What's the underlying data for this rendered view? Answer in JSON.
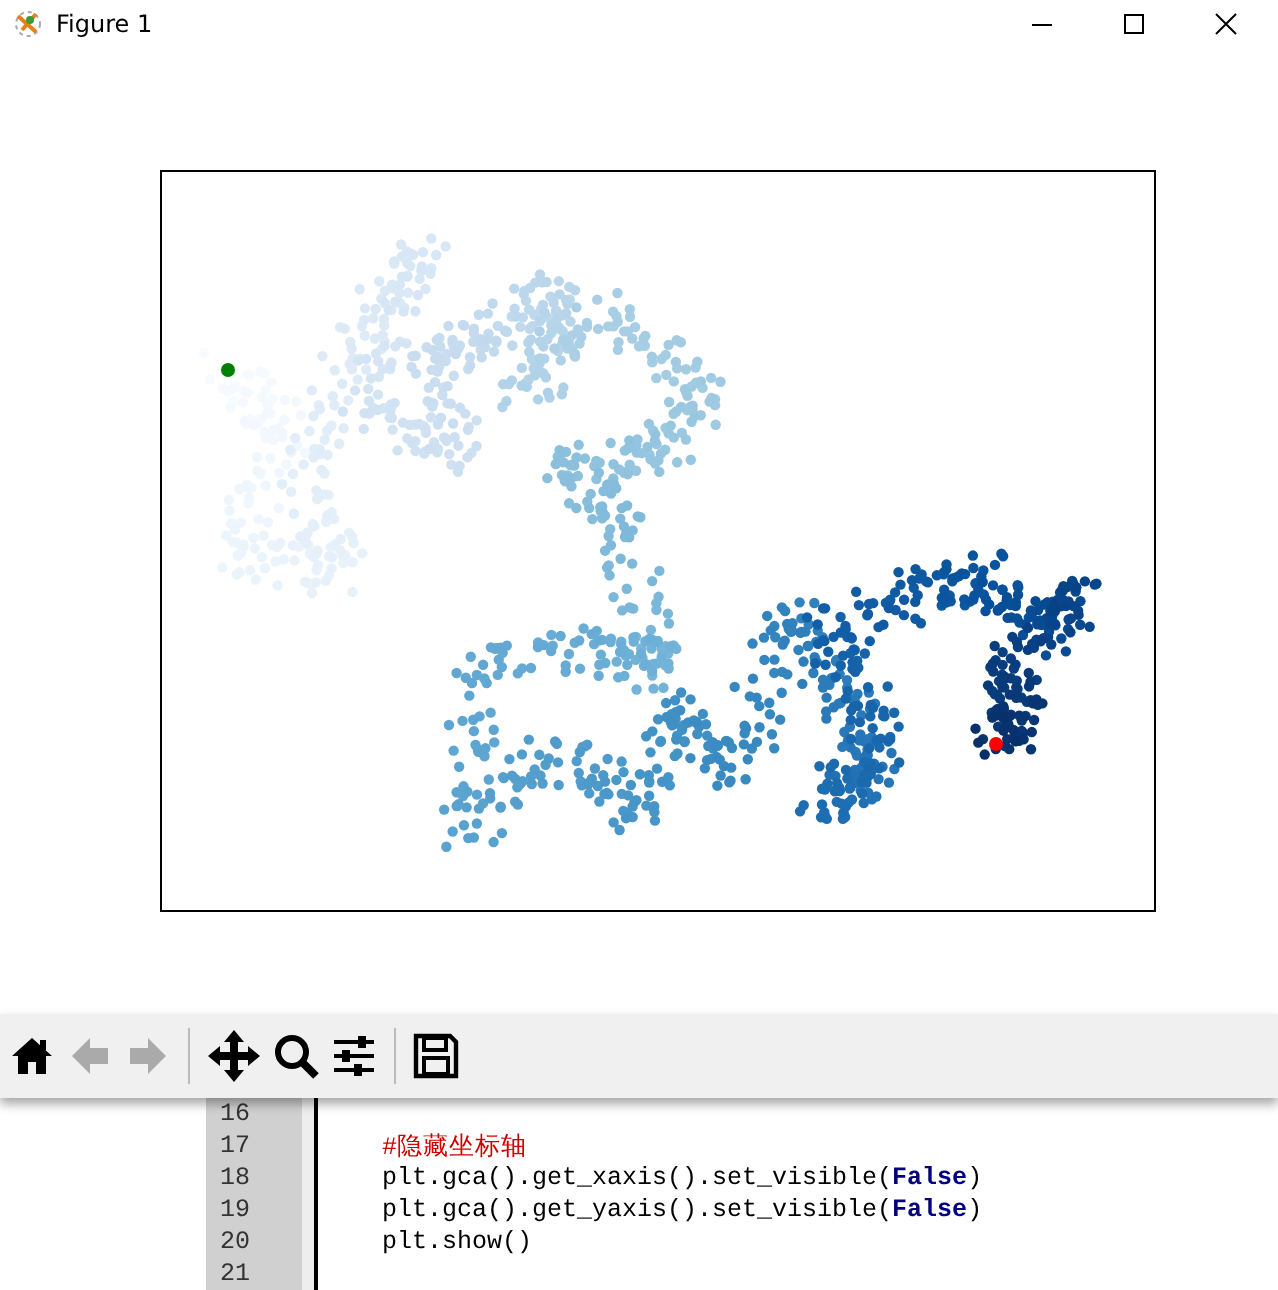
{
  "window": {
    "title": "Figure 1"
  },
  "toolbar": [
    {
      "kind": "home",
      "disabled": false
    },
    {
      "kind": "back",
      "disabled": true
    },
    {
      "kind": "forward",
      "disabled": true
    },
    {
      "kind": "separator"
    },
    {
      "kind": "pan",
      "disabled": false
    },
    {
      "kind": "zoom",
      "disabled": false
    },
    {
      "kind": "configure",
      "disabled": false
    },
    {
      "kind": "separator"
    },
    {
      "kind": "save",
      "disabled": false
    }
  ],
  "code_lines": [
    {
      "number": "16"
    },
    {
      "number": "17",
      "parts": [
        {
          "kind": "comment",
          "text": "#隐藏坐标轴"
        }
      ]
    },
    {
      "number": "18",
      "parts": [
        {
          "kind": "plain",
          "text": "plt.gca().get_xaxis().set_visible("
        },
        {
          "kind": "keyword",
          "text": "False"
        },
        {
          "kind": "plain",
          "text": ")"
        }
      ]
    },
    {
      "number": "19",
      "parts": [
        {
          "kind": "plain",
          "text": "plt.gca().get_yaxis().set_visible("
        },
        {
          "kind": "keyword",
          "text": "False"
        },
        {
          "kind": "plain",
          "text": ")"
        }
      ]
    },
    {
      "number": "20",
      "parts": [
        {
          "kind": "plain",
          "text": "plt.show()"
        }
      ]
    },
    {
      "number": "21"
    }
  ]
}
